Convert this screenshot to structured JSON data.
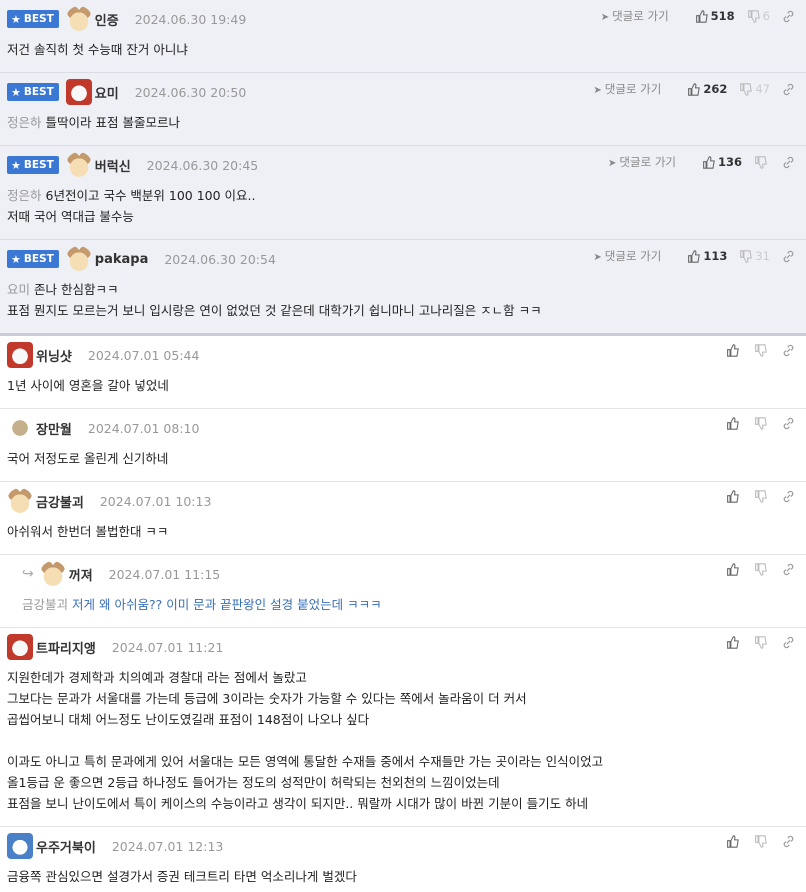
{
  "best_label": "BEST",
  "goto_label": "댓글로 가기",
  "comments": [
    {
      "nick": "인증",
      "date": "2024.06.30 19:49",
      "up": "518",
      "down": "6",
      "lines": [
        "저건 솔직히 첫 수능때 잔거 아니냐"
      ]
    },
    {
      "nick": "요미",
      "date": "2024.06.30 20:50",
      "up": "262",
      "down": "47",
      "mention": "정은하",
      "lines": [
        "틀딱이라 표점 볼줄모르나"
      ]
    },
    {
      "nick": "버럭신",
      "date": "2024.06.30 20:45",
      "up": "136",
      "down": "",
      "mention": "정은하",
      "lines": [
        "6년전이고 국수 백분위 100 100 이요..",
        "저때 국어 역대급 불수능"
      ]
    },
    {
      "nick": "pakapa",
      "date": "2024.06.30 20:54",
      "up": "113",
      "down": "31",
      "mention": "요미",
      "lines": [
        "존나 한심함ㅋㅋ",
        "표점 뭔지도 모르는거 보니 입시랑은 연이 없었던 것 같은데 대학가기 쉽니마니 고나리질은 ㅈㄴ함 ㅋㅋ"
      ]
    },
    {
      "nick": "위닝샷",
      "date": "2024.07.01 05:44",
      "lines": [
        "1년 사이에 영혼을 갈아 넣었네"
      ]
    },
    {
      "nick": "장만월",
      "date": "2024.07.01 08:10",
      "lines": [
        "국어 저정도로 올린게 신기하네"
      ]
    },
    {
      "nick": "금강불괴",
      "date": "2024.07.01 10:13",
      "lines": [
        "아쉬워서 한번더 볼법한대 ㅋㅋ"
      ]
    },
    {
      "nick": "꺼져",
      "date": "2024.07.01 11:15",
      "mention": "금강불괴",
      "lines": [
        "저게 왜 아쉬움?? 이미 문과 끝판왕인 설경 붙었는데 ㅋㅋㅋ"
      ]
    },
    {
      "nick": "트파리지앵",
      "date": "2024.07.01 11:21",
      "lines": [
        "지원한데가 경제학과 치의예과 경찰대 라는 점에서 놀랐고",
        "그보다는 문과가 서울대를 가는데 등급에 3이라는 숫자가 가능할 수 있다는 쪽에서 놀라움이 더 커서",
        "곱씹어보니 대체 어느정도 난이도였길래 표점이 148점이 나오나 싶다",
        "",
        "이과도 아니고 특히 문과에게 있어 서울대는 모든 영역에 통달한 수재들 중에서 수재들만 가는 곳이라는 인식이었고",
        "올1등급 운 좋으면 2등급 하나정도 들어가는 정도의 성적만이 허락되는 천외천의 느낌이었는데",
        "표점을 보니 난이도에서 특이 케이스의 수능이라고 생각이 되지만.. 뭐랄까 시대가 많이 바뀐 기분이 들기도 하네"
      ]
    },
    {
      "nick": "우주거북이",
      "date": "2024.07.01 12:13",
      "lines": [
        "금융쪽 관심있으면 설경가서 증권 테크트리 타면 억소리나게 벌겠다"
      ]
    }
  ]
}
